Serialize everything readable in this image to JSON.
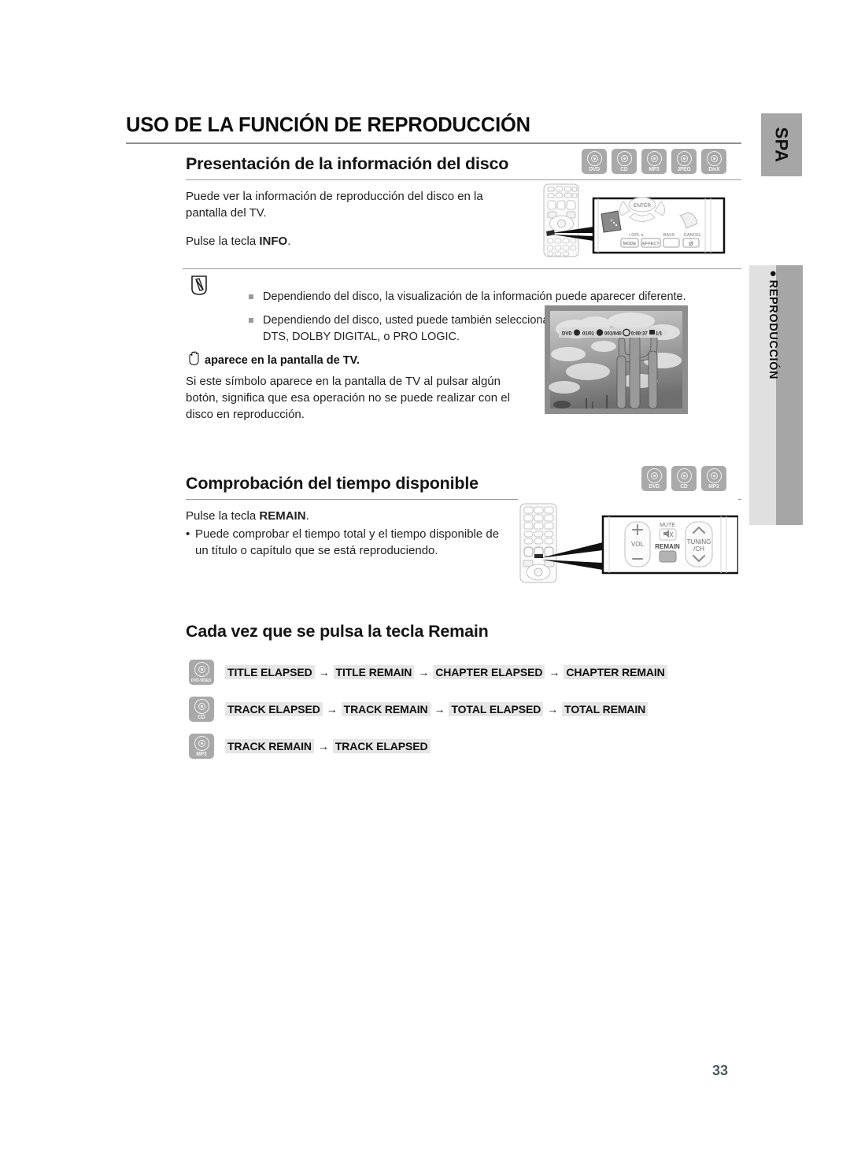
{
  "page": {
    "number": "33",
    "language_tab": "SPA",
    "side_chapter": "REPRODUCCIÓN",
    "side_chapter_bullet": "●"
  },
  "main_title": "USO DE LA FUNCIÓN DE REPRODUCCIÓN",
  "sections": [
    {
      "heading": "Presentación de la información del disco",
      "badges": [
        "DVD",
        "CD",
        "MP3",
        "JPEG",
        "DivX"
      ],
      "paragraph_1": "Puede ver la información de reproducción del disco en la pantalla del TV.",
      "paragraph_2_pre": "Pulse la tecla ",
      "paragraph_2_key": "INFO",
      "paragraph_2_post": "."
    },
    {
      "heading": "Comprobación del tiempo disponible",
      "badges": [
        "DVD",
        "CD",
        "MP3"
      ],
      "paragraph_1_pre": "Pulse la tecla ",
      "paragraph_1_key": "REMAIN",
      "paragraph_1_post": ".",
      "bullet": "Puede comprobar el tiempo total y el tiempo disponible de un título o capítulo que se está reproduciendo."
    }
  ],
  "note": {
    "icon": "note-pencil-icon",
    "items": [
      "Dependiendo del disco, la visualización de la información puede aparecer diferente.",
      "Dependiendo del disco, usted puede también seleccionar DTS, DOLBY DIGITAL, o PRO LOGIC."
    ],
    "hand_heading": "aparece en la pantalla de TV.",
    "hand_icon": "hand-stop-icon",
    "hand_paragraph": "Si este símbolo aparece en la pantalla de TV al pulsar algún botón, significa que esa operación no se puede realizar con el disco en reproducción."
  },
  "remain": {
    "heading": "Cada vez que se pulsa la tecla Remain",
    "arrow": "→",
    "rows": [
      {
        "badge": "DVD-VIDEO",
        "steps": [
          "TITLE ELAPSED",
          "TITLE REMAIN",
          "CHAPTER ELAPSED",
          "CHAPTER REMAIN"
        ]
      },
      {
        "badge": "CD",
        "steps": [
          "TRACK ELAPSED",
          "TRACK REMAIN",
          "TOTAL ELAPSED",
          "TOTAL REMAIN"
        ]
      },
      {
        "badge": "MP3",
        "steps": [
          "TRACK REMAIN",
          "TRACK ELAPSED"
        ]
      }
    ]
  },
  "tv_osd": {
    "disc_type": "DVD",
    "title": "01/01",
    "chapter": "001/040",
    "time": "0:00:37",
    "audio": "1/1"
  },
  "remote_zoom_1": {
    "enter_label": "ENTER",
    "keys": [
      "MODE",
      "EFFECT"
    ],
    "labels": [
      "DPL",
      "BASS",
      "CANCEL"
    ]
  },
  "remote_zoom_2": {
    "vol_label": "VOL",
    "mute_label": "MUTE",
    "remain_label": "REMAIN",
    "tuning_label": "TUNING",
    "tuning_sub": "/CH"
  },
  "colors": {
    "badge_gray": "#a9a9a9",
    "chip_gray": "#e6e6e6",
    "tab_gray": "#a6a6a6",
    "strip_light": "#e0e0e0",
    "rule_gray": "#9a9a9a",
    "page_num": "#4c5a5e"
  }
}
